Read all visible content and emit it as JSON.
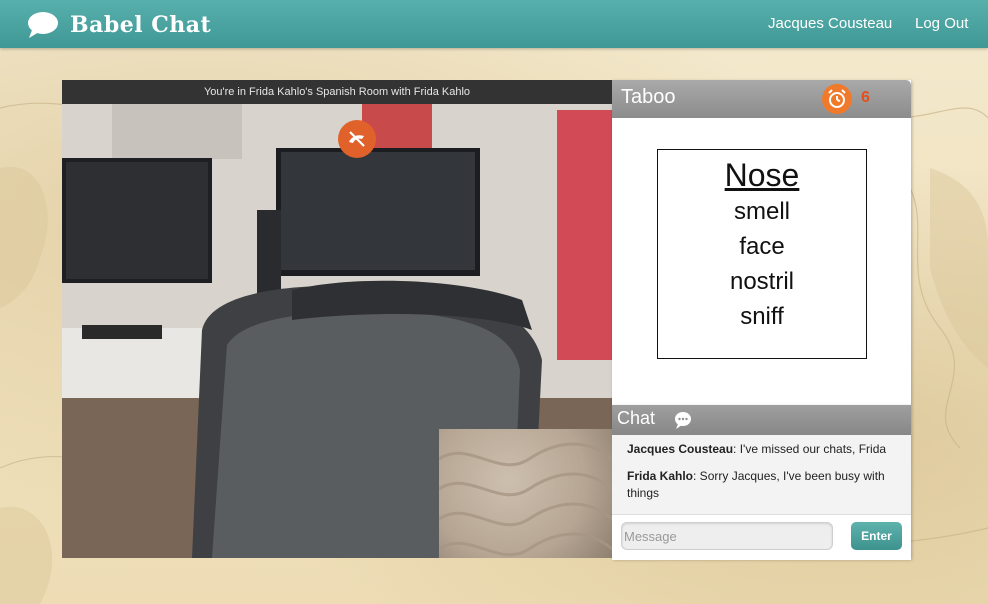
{
  "app": {
    "name": "Babel Chat",
    "accent_color": "#4aa5a2",
    "logo_icon": "speech-bubble-icon"
  },
  "nav": {
    "user_name": "Jacques Cousteau",
    "logout_label": "Log Out"
  },
  "video": {
    "room_banner": "You're in Frida Kahlo's Spanish Room with Frida Kahlo",
    "hangup_icon": "hang-up-phone-icon",
    "hangup_color": "#e0622a"
  },
  "taboo": {
    "title": "Taboo",
    "timer_icon": "alarm-clock-icon",
    "timer_value": "6",
    "card": {
      "word": "Nose",
      "taboo_words": [
        "smell",
        "face",
        "nostril",
        "sniff"
      ]
    }
  },
  "chat": {
    "title": "Chat",
    "icon": "chat-bubble-icon",
    "messages": [
      {
        "sender": "Jacques Cousteau",
        "text": ": I've missed our chats, Frida"
      },
      {
        "sender": "Frida Kahlo",
        "text": ": Sorry Jacques, I've been busy with things"
      }
    ],
    "input_placeholder": "Message",
    "input_value": "",
    "enter_label": "Enter"
  }
}
